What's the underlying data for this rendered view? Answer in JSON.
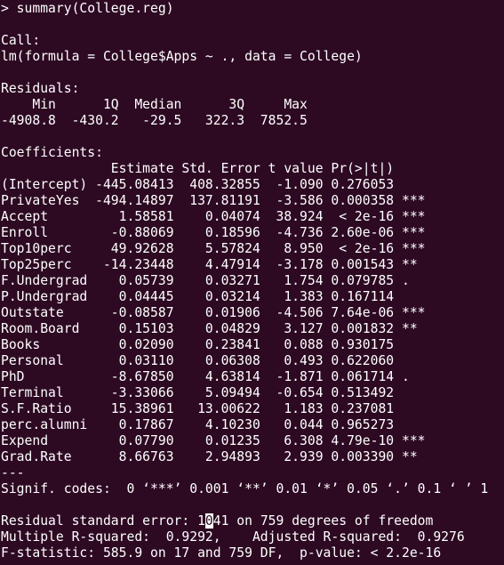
{
  "terminal": {
    "background": "#2d0922",
    "foreground": "#ffffff",
    "lines": [
      "> summary(College.reg)",
      "",
      "Call:",
      "lm(formula = College$Apps ~ ., data = College)",
      "",
      "Residuals:",
      "    Min      1Q  Median      3Q     Max ",
      "-4908.8  -430.2   -29.5   322.3  7852.5 ",
      "",
      "Coefficients:",
      "              Estimate Std. Error t value Pr(>|t|)    ",
      "(Intercept) -445.08413  408.32855  -1.090 0.276053    ",
      "PrivateYes  -494.14897  137.81191  -3.586 0.000358 ***",
      "Accept         1.58581    0.04074  38.924  < 2e-16 ***",
      "Enroll        -0.88069    0.18596  -4.736 2.60e-06 ***",
      "Top10perc     49.92628    5.57824   8.950  < 2e-16 ***",
      "Top25perc    -14.23448    4.47914  -3.178 0.001543 ** ",
      "F.Undergrad    0.05739    0.03271   1.754 0.079785 .  ",
      "P.Undergrad    0.04445    0.03214   1.383 0.167114    ",
      "Outstate      -0.08587    0.01906  -4.506 7.64e-06 ***",
      "Room.Board     0.15103    0.04829   3.127 0.001832 ** ",
      "Books          0.02090    0.23841   0.088 0.930175    ",
      "Personal       0.03110    0.06308   0.493 0.622060    ",
      "PhD           -8.67850    4.63814  -1.871 0.061714 .  ",
      "Terminal      -3.33066    5.09494  -0.654 0.513492    ",
      "S.F.Ratio     15.38961   13.00622   1.183 0.237081    ",
      "perc.alumni    0.17867    4.10230   0.044 0.965273    ",
      "Expend         0.07790    0.01235   6.308 4.79e-10 ***",
      "Grad.Rate      8.66763    2.94893   2.939 0.003390 ** ",
      "---",
      "Signif. codes:  0 ‘***’ 0.001 ‘**’ 0.01 ‘*’ 0.05 ‘.’ 0.1 ‘ ’ 1",
      ""
    ],
    "rse": {
      "before_cursor": "Residual standard error: 1",
      "cursor_char": "0",
      "after_cursor": "41 on 759 degrees of freedom"
    },
    "tail_lines": [
      "Multiple R-squared:  0.9292,\tAdjusted R-squared:  0.9276 ",
      "F-statistic: 585.9 on 17 and 759 DF,  p-value: < 2.2e-16"
    ]
  }
}
